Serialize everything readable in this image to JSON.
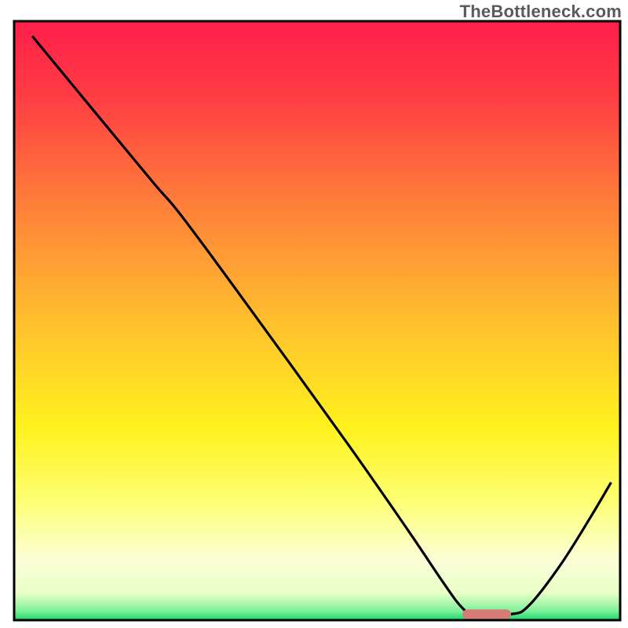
{
  "watermark": "TheBottleneck.com",
  "chart_data": {
    "type": "line",
    "title": "",
    "xlabel": "",
    "ylabel": "",
    "xlim": [
      0,
      100
    ],
    "ylim": [
      0,
      100
    ],
    "grid": false,
    "gradient_stops": [
      {
        "offset": 0.0,
        "color": "#ff1f4b"
      },
      {
        "offset": 0.12,
        "color": "#ff3b44"
      },
      {
        "offset": 0.3,
        "color": "#ff7d3a"
      },
      {
        "offset": 0.5,
        "color": "#ffbf2e"
      },
      {
        "offset": 0.68,
        "color": "#fff21e"
      },
      {
        "offset": 0.8,
        "color": "#fdff72"
      },
      {
        "offset": 0.9,
        "color": "#fbffd8"
      },
      {
        "offset": 0.955,
        "color": "#e8ffc8"
      },
      {
        "offset": 0.985,
        "color": "#7ef099"
      },
      {
        "offset": 1.0,
        "color": "#17d46a"
      }
    ],
    "curve_points": [
      {
        "x": 3.0,
        "y": 97.5
      },
      {
        "x": 14.0,
        "y": 84.0
      },
      {
        "x": 23.0,
        "y": 73.0
      },
      {
        "x": 28.0,
        "y": 67.0
      },
      {
        "x": 40.0,
        "y": 50.5
      },
      {
        "x": 55.0,
        "y": 29.5
      },
      {
        "x": 65.0,
        "y": 15.0
      },
      {
        "x": 71.0,
        "y": 6.0
      },
      {
        "x": 74.0,
        "y": 2.0
      },
      {
        "x": 76.0,
        "y": 1.0
      },
      {
        "x": 82.0,
        "y": 1.0
      },
      {
        "x": 85.0,
        "y": 2.5
      },
      {
        "x": 90.0,
        "y": 9.0
      },
      {
        "x": 95.0,
        "y": 17.0
      },
      {
        "x": 98.5,
        "y": 23.0
      }
    ],
    "optimal_marker": {
      "x_start": 74.0,
      "x_end": 82.0,
      "y": 1.0,
      "color": "#d87a78"
    },
    "frame_color": "#000000",
    "curve_color": "#000000"
  }
}
